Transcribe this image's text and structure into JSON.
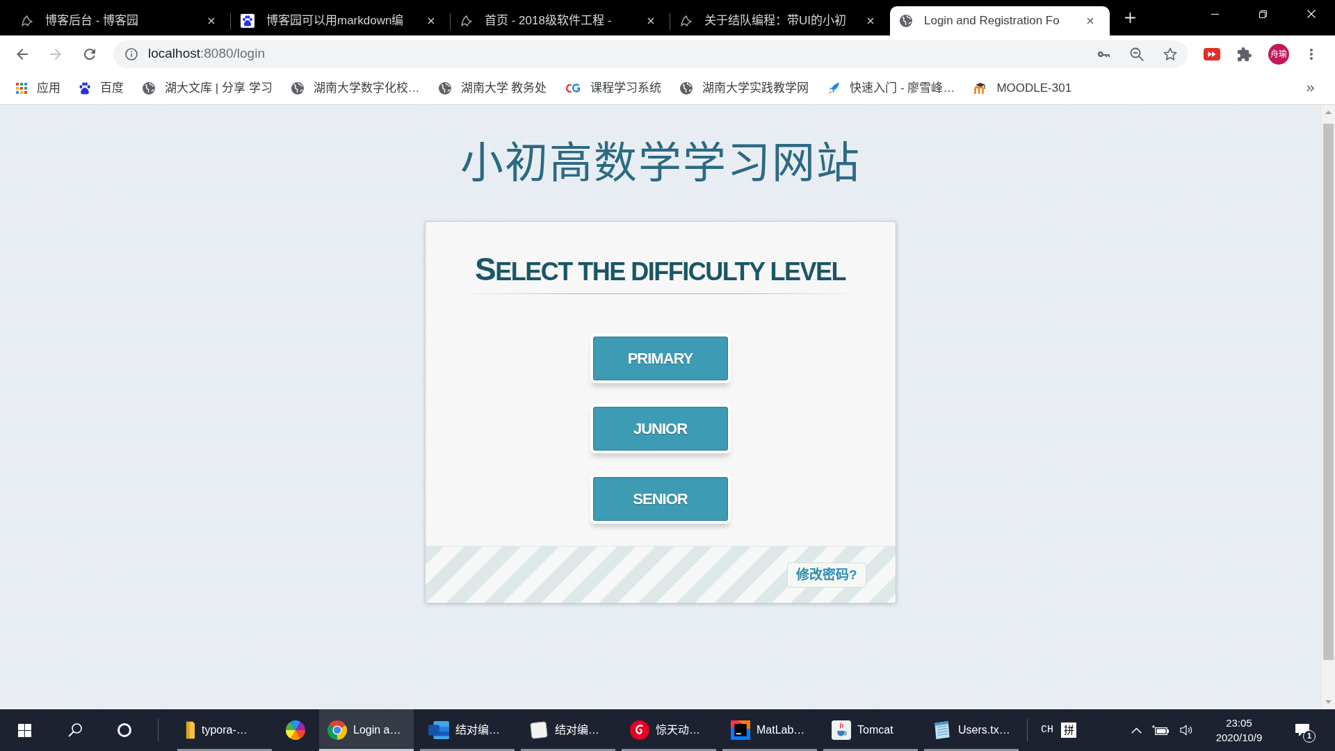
{
  "browser": {
    "tabs": [
      {
        "kind": "blog",
        "title": "博客后台 - 博客园",
        "selected": false
      },
      {
        "kind": "search",
        "title": "博客园可以用markdown编",
        "selected": false
      },
      {
        "kind": "blog",
        "title": "首页 - 2018级软件工程 -",
        "selected": false
      },
      {
        "kind": "blog",
        "title": "关于结队编程：带UI的小初",
        "selected": false
      },
      {
        "kind": "web",
        "title": "Login and Registration Fo",
        "selected": true
      }
    ],
    "nav_buttons": [
      {
        "kind": "back",
        "disabled": false
      },
      {
        "kind": "forward",
        "disabled": true
      },
      {
        "kind": "reload",
        "disabled": false
      }
    ],
    "address": {
      "host": "localhost",
      "path": ":8080/login"
    },
    "profile": {
      "initials": "舟瑜"
    },
    "bookmarks": [
      {
        "kind": "apps",
        "label": "应用"
      },
      {
        "kind": "search",
        "label": "百度"
      },
      {
        "kind": "web",
        "label": "湖大文库 | 分享 学习"
      },
      {
        "kind": "web",
        "label": "湖南大学数字化校…"
      },
      {
        "kind": "web",
        "label": "湖南大学 教务处"
      },
      {
        "kind": "course",
        "label": "课程学习系统"
      },
      {
        "kind": "web",
        "label": "湖南大学实践教学网"
      },
      {
        "kind": "tutorial",
        "label": "快速入门 - 廖雪峰…"
      },
      {
        "kind": "lms",
        "label": "MOODLE-301"
      }
    ]
  },
  "page": {
    "site_title": "小初高数学学习网站",
    "panel": {
      "heading": "SELECT THE DIFFICULTY LEVEL",
      "levels": [
        {
          "label": "PRIMARY"
        },
        {
          "label": "JUNIOR"
        },
        {
          "label": "SENIOR"
        }
      ],
      "footer_link": "修改密码?"
    }
  },
  "taskbar": {
    "apps": [
      {
        "kind": "folder",
        "label": "typora-…",
        "selected": false,
        "running": true
      },
      {
        "kind": "pinwheel",
        "selected": false,
        "running": false
      },
      {
        "kind": "browser",
        "label": "Login a…",
        "selected": true,
        "running": true
      },
      {
        "kind": "word",
        "label": "结对编…",
        "selected": false,
        "running": true
      },
      {
        "kind": "typora",
        "label": "结对编…",
        "selected": false,
        "running": true
      },
      {
        "kind": "music",
        "label": "惊天动…",
        "selected": false,
        "running": true
      },
      {
        "kind": "ide",
        "label": "MatLab…",
        "selected": false,
        "running": true
      },
      {
        "kind": "java",
        "label": "Tomcat",
        "selected": false,
        "running": true
      },
      {
        "kind": "notepad",
        "label": "Users.tx…",
        "selected": false,
        "running": true
      }
    ],
    "input_language": "CH",
    "input_mode": "拼",
    "time": "23:05",
    "date": "2020/10/9",
    "notification_count": "1"
  }
}
